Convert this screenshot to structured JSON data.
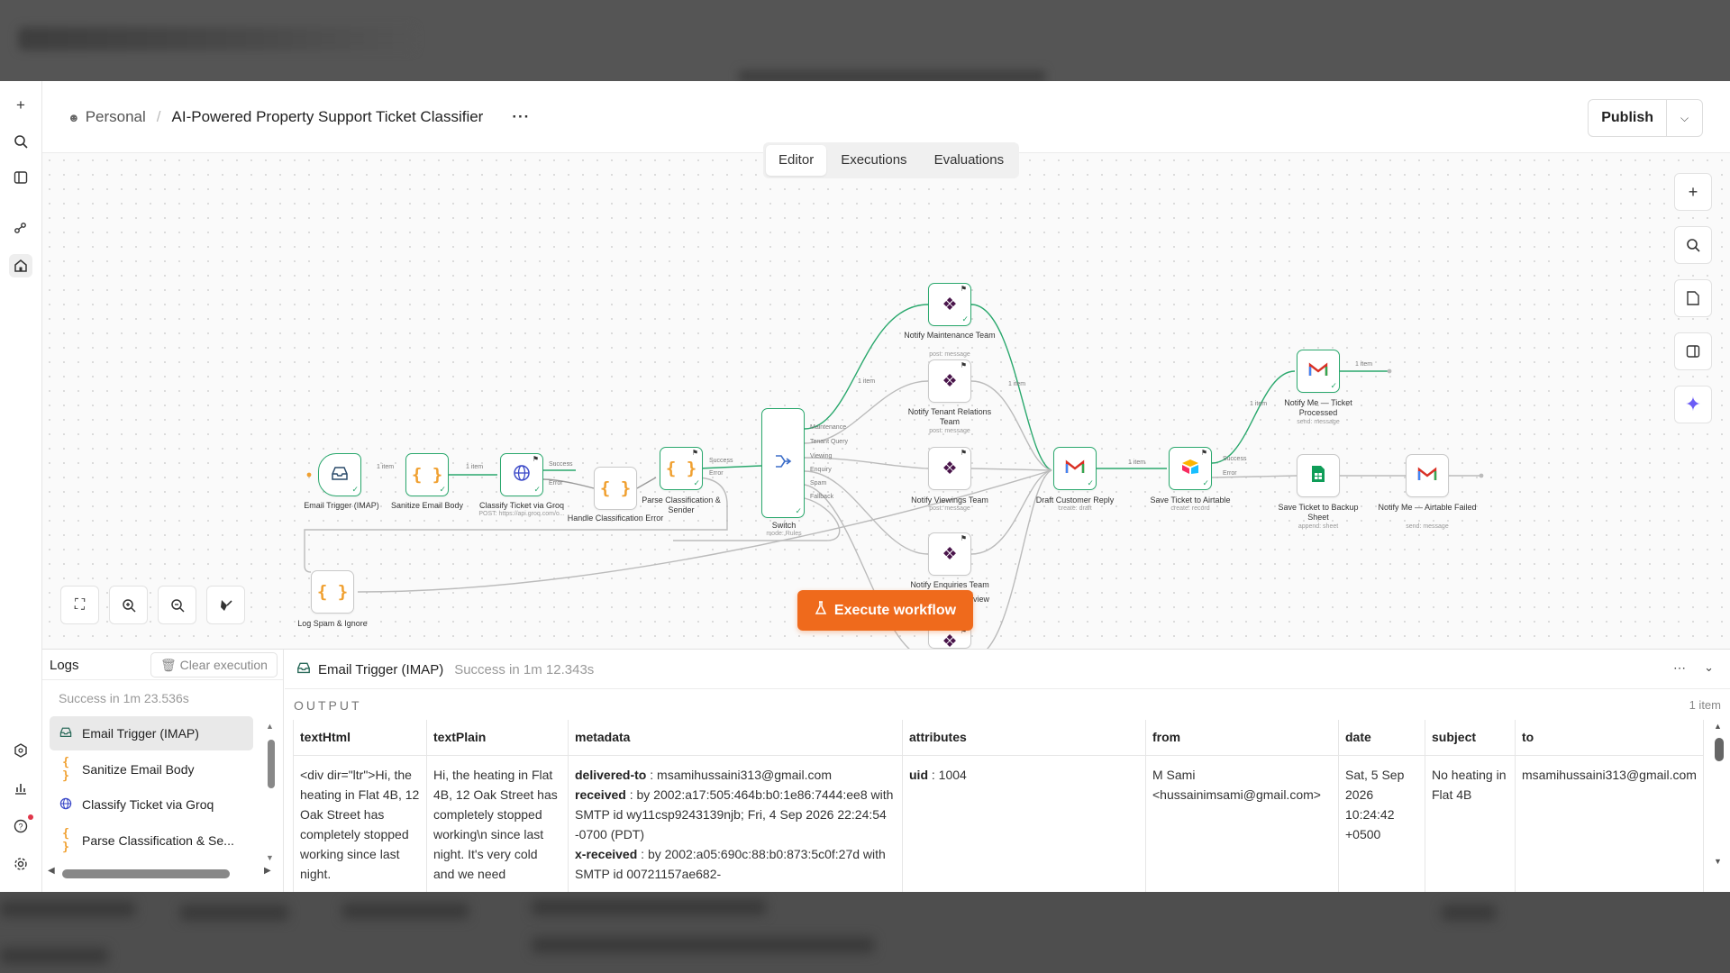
{
  "breadcrumb": {
    "workspace": "Personal",
    "title": "AI-Powered Property Support Ticket Classifier",
    "more": "···"
  },
  "publish": {
    "label": "Publish"
  },
  "tabs": [
    "Editor",
    "Executions",
    "Evaluations"
  ],
  "execute_label": "Execute workflow",
  "nodes": {
    "email_trigger": {
      "label": "Email Trigger (IMAP)"
    },
    "sanitize": {
      "label": "Sanitize Email Body"
    },
    "classify": {
      "label": "Classify Ticket via Groq",
      "sub": "POST: https://api.groq.com/o..."
    },
    "handle_error": {
      "label": "Handle Classification Error"
    },
    "parse": {
      "label": "Parse Classification & Sender"
    },
    "switch": {
      "label": "Switch",
      "sub": "mode: Rules",
      "outputs": [
        "Maintenance",
        "Tenant Query",
        "Viewing",
        "Enquiry",
        "Spam",
        "Fallback"
      ]
    },
    "notify_maintenance": {
      "label": "Notify Maintenance Team",
      "sub": "post: message"
    },
    "notify_tenant": {
      "label": "Notify Tenant Relations Team",
      "sub": "post: message"
    },
    "notify_viewings": {
      "label": "Notify Viewings Team",
      "sub": "post: message"
    },
    "notify_enquiries": {
      "label": "Notify Enquiries Team",
      "sub": "post: message"
    },
    "notify_review": {
      "label": "view",
      "sub": "post: message"
    },
    "log_spam": {
      "label": "Log Spam & Ignore"
    },
    "draft_reply": {
      "label": "Draft Customer Reply",
      "sub": "create: draft"
    },
    "save_airtable": {
      "label": "Save Ticket to Airtable",
      "sub": "create: record"
    },
    "notify_me_processed": {
      "label": "Notify Me — Ticket Processed",
      "sub": "send: message"
    },
    "save_sheet": {
      "label": "Save Ticket to Backup Sheet",
      "sub": "append: sheet"
    },
    "notify_me_failed": {
      "label": "Notify Me — Airtable Failed",
      "sub": "send: message"
    }
  },
  "edge_labels": {
    "item1": "1 item",
    "success": "Success",
    "error": "Error"
  },
  "logs": {
    "title": "Logs",
    "clear": "Clear execution",
    "summary": "Success in 1m 23.536s",
    "items": [
      "Email Trigger (IMAP)",
      "Sanitize Email Body",
      "Classify Ticket via Groq",
      "Parse Classification & Se..."
    ]
  },
  "output": {
    "node": "Email Trigger (IMAP)",
    "status": "Success in 1m 12.343s",
    "label": "OUTPUT",
    "count": "1 item",
    "columns": [
      "textHtml",
      "textPlain",
      "metadata",
      "attributes",
      "from",
      "date",
      "subject",
      "to"
    ],
    "row": {
      "textHtml": "<div dir=\"ltr\">Hi, the heating in Flat 4B, 12 Oak Street has completely stopped working since last night.",
      "textPlain": "Hi, the heating in Flat 4B, 12 Oak Street has completely stopped working\\n since last night. It's very cold and we need",
      "meta_delivered_key": "delivered-to",
      "meta_delivered_val": "msamihussaini313@gmail.com",
      "meta_received_key": "received",
      "meta_received_val": "by 2002:a17:505:464b:b0:1e86:7444:ee8 with SMTP id wy11csp9243139njb; Fri, 4 Sep 2026 22:24:54 -0700 (PDT)",
      "meta_xreceived_key": "x-received",
      "meta_xreceived_val": "by 2002:a05:690c:88:b0:873:5c0f:27d with SMTP id 00721157ae682-",
      "attr_key": "uid",
      "attr_val": "1004",
      "from": "M Sami <hussainimsami@gmail.com>",
      "date": "Sat, 5 Sep 2026 10:24:42 +0500",
      "subject": "No heating in Flat 4B",
      "to": "msamihussaini313@gmail.com"
    }
  },
  "colors": {
    "accent": "#ef6a1c",
    "success": "#2aa86d",
    "ai": "#6b5cf6"
  }
}
